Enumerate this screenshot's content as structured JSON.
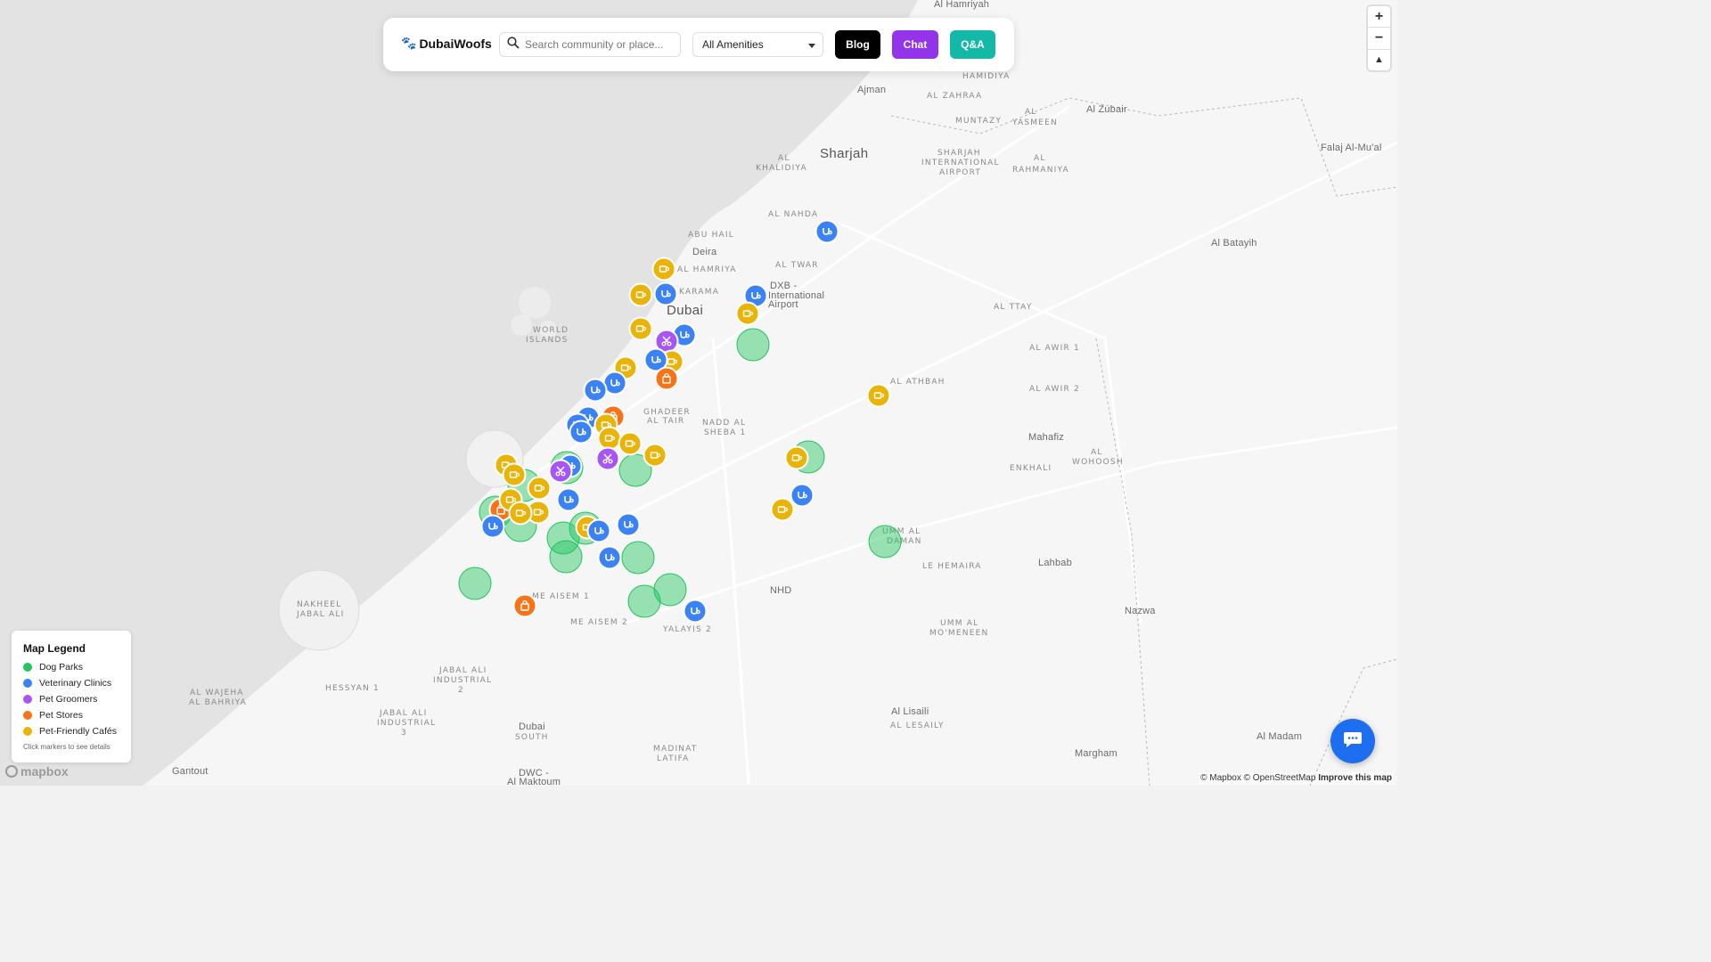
{
  "brand": {
    "name": "DubaiWoofs",
    "icon": "paw-icon"
  },
  "search": {
    "placeholder": "Search community or place..."
  },
  "filter": {
    "selected": "All Amenities"
  },
  "nav": {
    "blog": "Blog",
    "chat": "Chat",
    "qa": "Q&A"
  },
  "colors": {
    "dog_park": "#22c55e",
    "vet": "#3b82f6",
    "groomer": "#a855f7",
    "store": "#f97316",
    "cafe": "#eab308",
    "chat": "#9333ea",
    "qa": "#14b8a6",
    "fab": "#1e6ff0"
  },
  "zoom": {
    "in": "+",
    "out": "−",
    "compass": "▲"
  },
  "legend": {
    "title": "Map Legend",
    "items": [
      {
        "label": "Dog Parks",
        "color": "#22c55e"
      },
      {
        "label": "Veterinary Clinics",
        "color": "#3b82f6"
      },
      {
        "label": "Pet Groomers",
        "color": "#a855f7"
      },
      {
        "label": "Pet Stores",
        "color": "#f97316"
      },
      {
        "label": "Pet-Friendly Cafés",
        "color": "#eab308"
      }
    ],
    "hint": "Click markers to see details"
  },
  "map_labels": {
    "hamriyah": "Al Hamriyah",
    "ajman": "Ajman",
    "hamidiya": "HAMIDIYA",
    "zahraa": "AL ZAHRAA",
    "muntazy": "MUNTAZY",
    "yasmeen_1": "AL",
    "yasmeen_2": "YASMEEN",
    "zubair": "Al Zubair",
    "sharjah": "Sharjah",
    "khalidiya_1": "AL",
    "khalidiya_2": "KHALIDIYA",
    "sia_1": "SHARJAH",
    "sia_2": "INTERNATIONAL",
    "sia_3": "AIRPORT",
    "rahmaniya_1": "AL",
    "rahmaniya_2": "RAHMANIYA",
    "falaj": "Falaj Al-Mu'al",
    "nahda": "AL NAHDA",
    "abuhail": "ABU HAIL",
    "deira": "Deira",
    "batayih": "Al Batayih",
    "hamriya": "AL HAMRIYA",
    "twar": "AL TWAR",
    "dxb_1": "DXB -",
    "dxb_2": "International",
    "dxb_3": "Airport",
    "ttay": "AL TTAY",
    "dubai": "Dubai",
    "worldislands_1": "WORLD",
    "worldislands_2": "ISLANDS",
    "karama": "KARAMA",
    "awir1": "AL AWIR 1",
    "athbah": "AL ATHBAH",
    "awir2": "AL AWIR 2",
    "ghadeer_1": "GHADEER",
    "ghadeer_2": "AL TAIR",
    "nadd_1": "NADD AL",
    "nadd_2": "SHEBA 1",
    "mahafiz": "Mahafiz",
    "enkhali": "ENKHALI",
    "wohoosh_1": "AL",
    "wohoosh_2": "WOHOOSH",
    "ummdaman_1": "UMM AL",
    "ummdaman_2": "DAMAN",
    "hemaira": "LE HEMAIRA",
    "lahbab": "Lahbab",
    "aisem1": "ME AISEM 1",
    "nhd": "NHD",
    "nazwa": "Nazwa",
    "aisem2": "ME AISEM 2",
    "yalayis": "YALAYIS 2",
    "ummmoneen_1": "UMM AL",
    "ummmoneen_2": "MO'MENEEN",
    "jabalali2_1": "JABAL ALI",
    "jabalali2_2": "INDUSTRIAL",
    "jabalali2_3": "2",
    "hessyan": "HESSYAN 1",
    "wajeha_1": "AL WAJEHA",
    "wajeha_2": "AL BAHRIYA",
    "jabalali3_1": "JABAL ALI",
    "jabalali3_2": "INDUSTRIAL",
    "jabalali3_3": "3",
    "dubaisouth_1": "Dubai",
    "dubaisouth_2": "SOUTH",
    "lisaili": "Al Lisaili",
    "lesaily": "AL LESAILY",
    "madinat_1": "MADINAT",
    "madinat_2": "LATIFA",
    "madam": "Al Madam",
    "margham": "Margham",
    "gantout": "Gantout",
    "dwc_1": "DWC -",
    "dwc_2": "Al Maktoum",
    "nakheel_1": "NAKHEEL",
    "nakheel_2": "JABAL ALI"
  },
  "map_markers": [
    {
      "kind": "vet",
      "icon": "stethoscope-icon"
    },
    {
      "kind": "cafe",
      "icon": "coffee-icon"
    },
    {
      "kind": "cafe",
      "icon": "coffee-icon"
    },
    {
      "kind": "vet",
      "icon": "stethoscope-icon"
    },
    {
      "kind": "vet",
      "icon": "stethoscope-icon"
    },
    {
      "kind": "cafe",
      "icon": "coffee-icon"
    },
    {
      "kind": "cafe",
      "icon": "coffee-icon"
    },
    {
      "kind": "vet",
      "icon": "stethoscope-icon"
    },
    {
      "kind": "groomer",
      "icon": "scissors-icon"
    },
    {
      "kind": "cafe",
      "icon": "coffee-icon"
    },
    {
      "kind": "vet",
      "icon": "stethoscope-icon"
    },
    {
      "kind": "store",
      "icon": "shopping-bag-icon"
    },
    {
      "kind": "cafe",
      "icon": "coffee-icon"
    },
    {
      "kind": "vet",
      "icon": "stethoscope-icon"
    },
    {
      "kind": "vet",
      "icon": "stethoscope-icon"
    },
    {
      "kind": "vet",
      "icon": "stethoscope-icon"
    },
    {
      "kind": "store",
      "icon": "shopping-bag-icon"
    },
    {
      "kind": "vet",
      "icon": "stethoscope-icon"
    },
    {
      "kind": "cafe",
      "icon": "coffee-icon"
    },
    {
      "kind": "cafe",
      "icon": "coffee-icon"
    },
    {
      "kind": "cafe",
      "icon": "coffee-icon"
    },
    {
      "kind": "cafe",
      "icon": "coffee-icon"
    },
    {
      "kind": "cafe",
      "icon": "coffee-icon"
    },
    {
      "kind": "groomer",
      "icon": "scissors-icon"
    },
    {
      "kind": "vet",
      "icon": "stethoscope-icon"
    },
    {
      "kind": "groomer",
      "icon": "scissors-icon"
    },
    {
      "kind": "cafe",
      "icon": "coffee-icon"
    },
    {
      "kind": "cafe",
      "icon": "coffee-icon"
    },
    {
      "kind": "vet",
      "icon": "stethoscope-icon"
    },
    {
      "kind": "cafe",
      "icon": "coffee-icon"
    },
    {
      "kind": "store",
      "icon": "shopping-bag-icon"
    },
    {
      "kind": "vet",
      "icon": "stethoscope-icon"
    },
    {
      "kind": "cafe",
      "icon": "coffee-icon"
    },
    {
      "kind": "cafe",
      "icon": "coffee-icon"
    },
    {
      "kind": "cafe",
      "icon": "coffee-icon"
    },
    {
      "kind": "vet",
      "icon": "stethoscope-icon"
    },
    {
      "kind": "vet",
      "icon": "stethoscope-icon"
    },
    {
      "kind": "cafe",
      "icon": "coffee-icon"
    },
    {
      "kind": "vet",
      "icon": "stethoscope-icon"
    },
    {
      "kind": "vet",
      "icon": "stethoscope-icon"
    },
    {
      "kind": "store",
      "icon": "shopping-bag-icon"
    },
    {
      "kind": "vet",
      "icon": "stethoscope-icon"
    },
    {
      "kind": "cafe",
      "icon": "coffee-icon"
    },
    {
      "kind": "cafe",
      "icon": "coffee-icon"
    },
    {
      "kind": "vet",
      "icon": "stethoscope-icon"
    }
  ],
  "attribution": {
    "mapbox": "© Mapbox",
    "osm": "© OpenStreetMap",
    "improve": "Improve this map"
  },
  "mapbox_logo": "mapbox"
}
